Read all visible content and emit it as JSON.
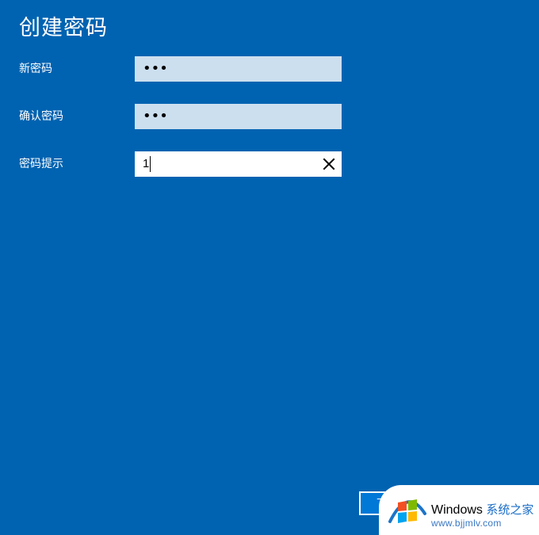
{
  "dialog": {
    "title": "创建密码"
  },
  "fields": {
    "new_password": {
      "label": "新密码",
      "value": "•••"
    },
    "confirm_password": {
      "label": "确认密码",
      "value": "•••"
    },
    "password_hint": {
      "label": "密码提示",
      "value": "1"
    }
  },
  "buttons": {
    "next_label": "下",
    "cancel_label": ""
  },
  "watermark": {
    "brand": "Windows",
    "brand_sub": "系统之家",
    "url": "www.bjjmlv.com"
  },
  "colors": {
    "background": "#0063B1",
    "password_field": "#CCDFEF",
    "active_field": "#FFFFFF",
    "next_button": "#0078D7"
  },
  "icons": {
    "clear": "close-icon",
    "watermark_logo": "windows-logo-icon"
  }
}
